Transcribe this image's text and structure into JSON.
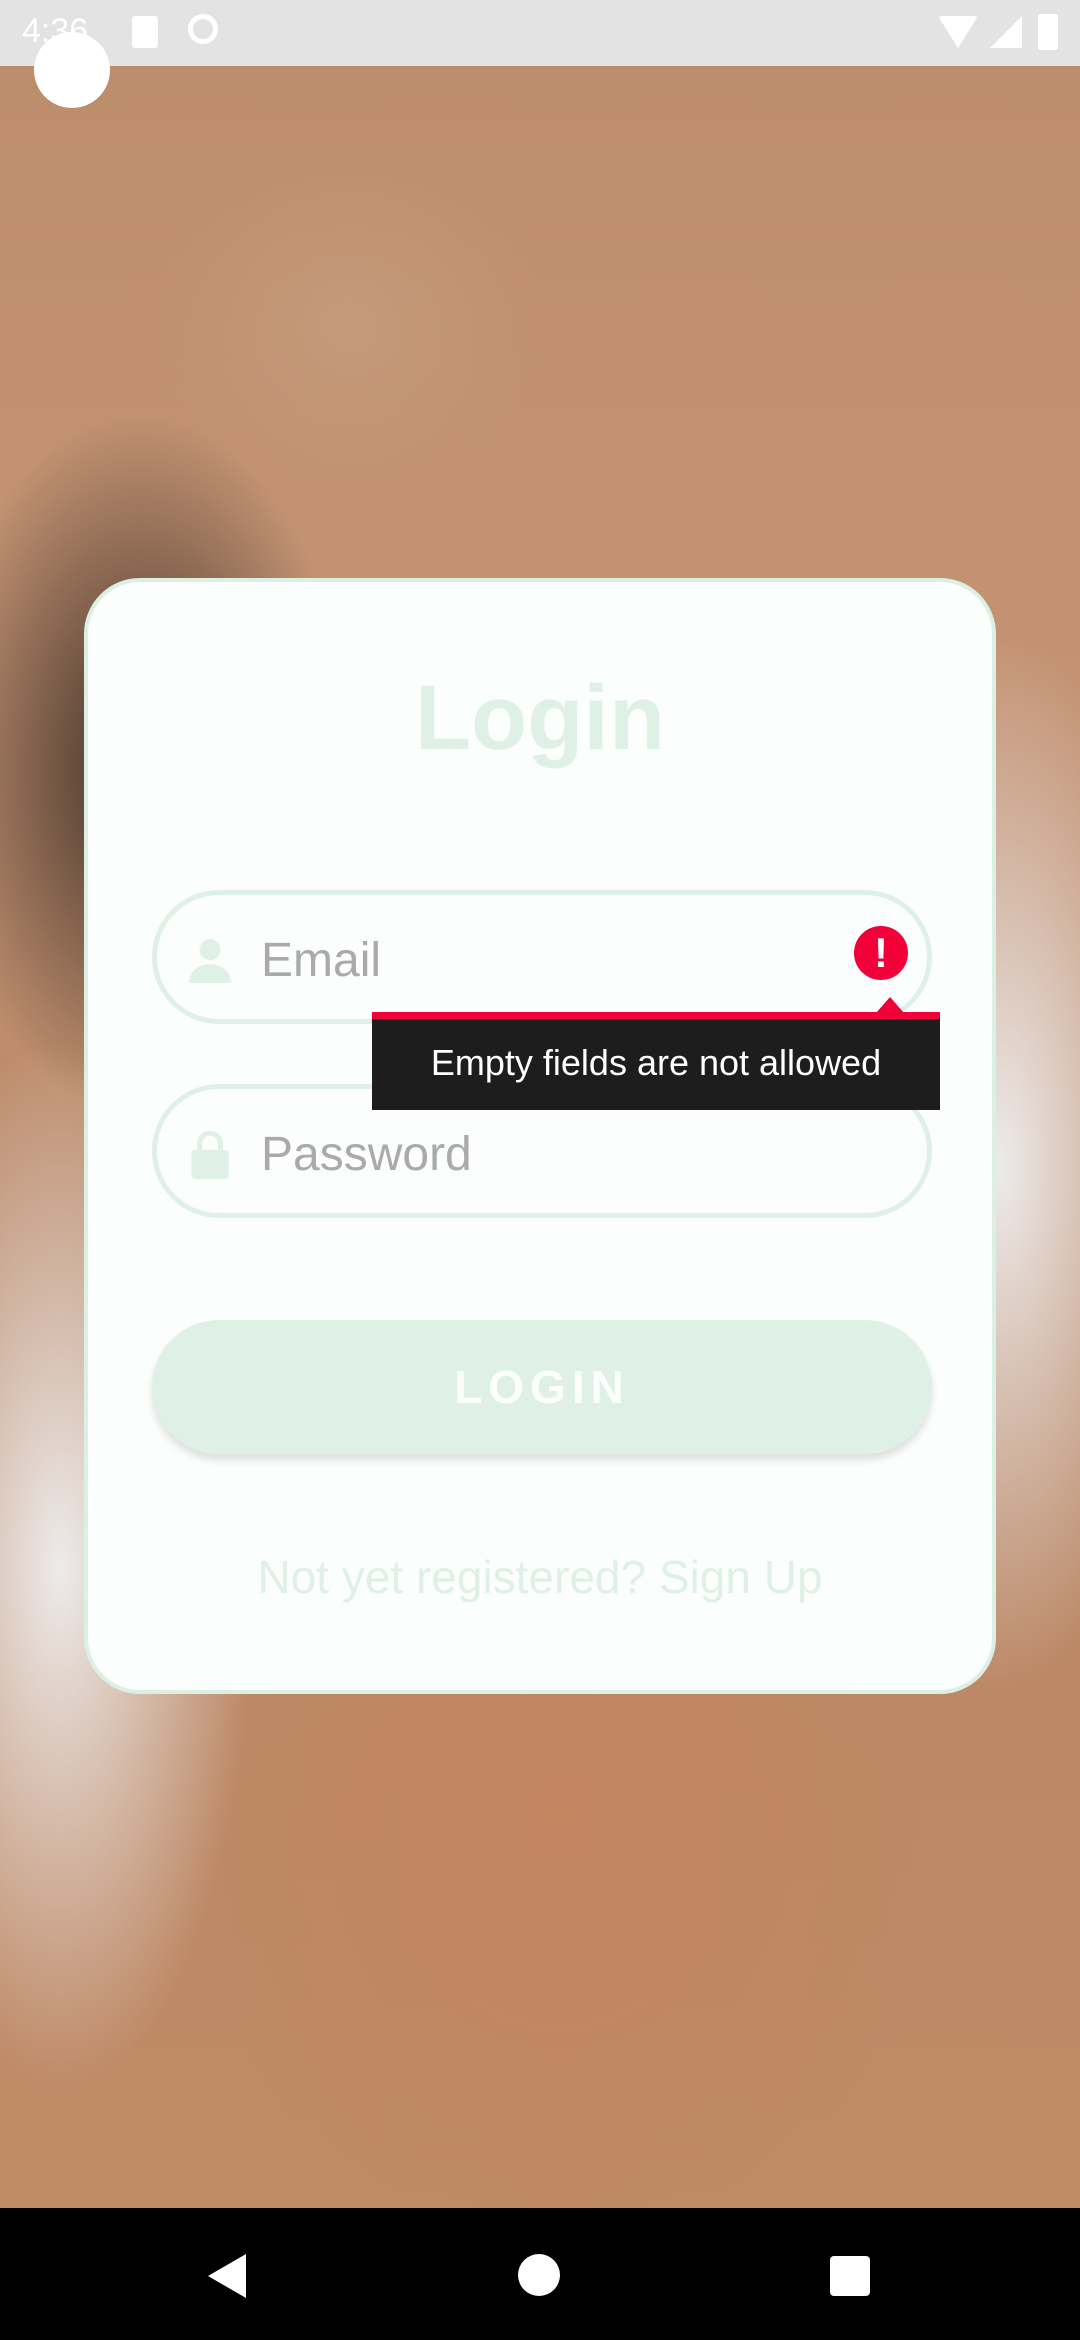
{
  "status_bar": {
    "time": "4:36",
    "icons": [
      "sd-card-icon",
      "do-not-disturb-icon",
      "wifi-icon",
      "signal-icon",
      "battery-icon"
    ]
  },
  "login_card": {
    "title": "Login",
    "email": {
      "placeholder": "Email",
      "icon": "person-icon",
      "error_icon": "error-icon"
    },
    "password": {
      "placeholder": "Password",
      "icon": "lock-icon"
    },
    "error_tooltip": "Empty fields are not allowed",
    "login_button": "LOGIN",
    "signup_link": "Not yet registered? Sign Up"
  },
  "colors": {
    "accent": "#dff1e7",
    "error": "#f1003a",
    "tooltip_bg": "#1d1d1d"
  },
  "nav_bar": {
    "icons": [
      "back-icon",
      "home-icon",
      "recent-apps-icon"
    ]
  }
}
